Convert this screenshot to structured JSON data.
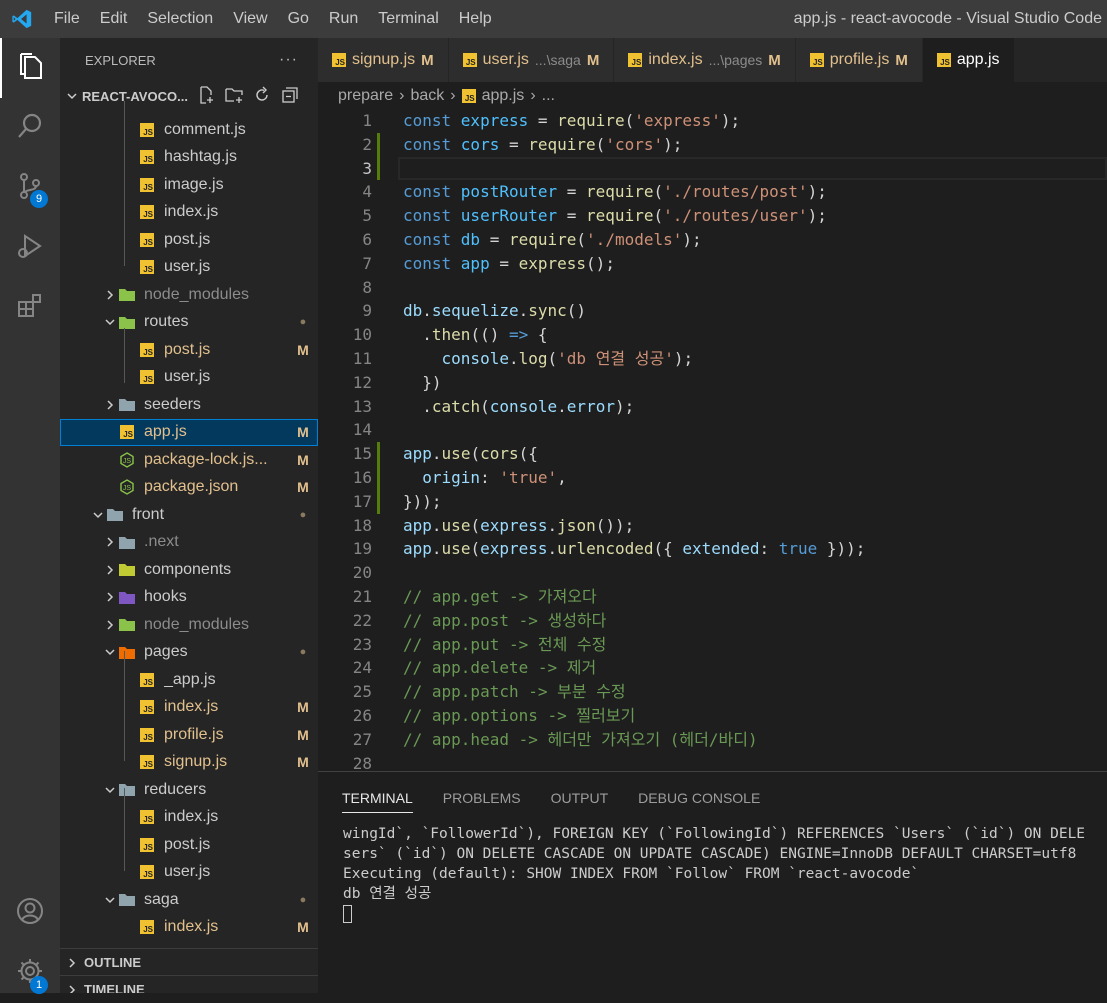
{
  "titlebar": {
    "menu": [
      "File",
      "Edit",
      "Selection",
      "View",
      "Go",
      "Run",
      "Terminal",
      "Help"
    ],
    "title": "app.js - react-avocode - Visual Studio Code"
  },
  "activitybar": {
    "scm_badge": "9",
    "settings_badge": "1"
  },
  "sidebar": {
    "header": "EXPLORER",
    "more": "···",
    "workspace": "REACT-AVOCO...",
    "outline": "OUTLINE",
    "timeline": "TIMELINE",
    "tree": [
      {
        "name": "comment.js",
        "type": "js",
        "depth": 3,
        "status": ""
      },
      {
        "name": "hashtag.js",
        "type": "js",
        "depth": 3,
        "status": ""
      },
      {
        "name": "image.js",
        "type": "js",
        "depth": 3,
        "status": ""
      },
      {
        "name": "index.js",
        "type": "js",
        "depth": 3,
        "status": ""
      },
      {
        "name": "post.js",
        "type": "js",
        "depth": 3,
        "status": ""
      },
      {
        "name": "user.js",
        "type": "js",
        "depth": 3,
        "status": ""
      },
      {
        "name": "node_modules",
        "type": "folder-node",
        "depth": 2,
        "chev": "right",
        "status": "",
        "dim": true
      },
      {
        "name": "routes",
        "type": "folder-routes",
        "depth": 2,
        "chev": "down",
        "status": "dot"
      },
      {
        "name": "post.js",
        "type": "js",
        "depth": 3,
        "status": "M"
      },
      {
        "name": "user.js",
        "type": "js",
        "depth": 3,
        "status": ""
      },
      {
        "name": "seeders",
        "type": "folder",
        "depth": 2,
        "chev": "right",
        "status": ""
      },
      {
        "name": "app.js",
        "type": "js",
        "depth": 2,
        "status": "M",
        "selected": true
      },
      {
        "name": "package-lock.js...",
        "type": "json",
        "depth": 2,
        "status": "M"
      },
      {
        "name": "package.json",
        "type": "json",
        "depth": 2,
        "status": "M"
      },
      {
        "name": "front",
        "type": "folder-open",
        "depth": 1,
        "chev": "down",
        "status": "dot"
      },
      {
        "name": ".next",
        "type": "folder-next",
        "depth": 2,
        "chev": "right",
        "status": "",
        "dim": true
      },
      {
        "name": "components",
        "type": "folder-comp",
        "depth": 2,
        "chev": "right",
        "status": ""
      },
      {
        "name": "hooks",
        "type": "folder-hooks",
        "depth": 2,
        "chev": "right",
        "status": ""
      },
      {
        "name": "node_modules",
        "type": "folder-node",
        "depth": 2,
        "chev": "right",
        "status": "",
        "dim": true
      },
      {
        "name": "pages",
        "type": "folder-pages",
        "depth": 2,
        "chev": "down",
        "status": "dot"
      },
      {
        "name": "_app.js",
        "type": "js",
        "depth": 3,
        "status": ""
      },
      {
        "name": "index.js",
        "type": "js",
        "depth": 3,
        "status": "M"
      },
      {
        "name": "profile.js",
        "type": "js",
        "depth": 3,
        "status": "M"
      },
      {
        "name": "signup.js",
        "type": "js",
        "depth": 3,
        "status": "M"
      },
      {
        "name": "reducers",
        "type": "folder-open",
        "depth": 2,
        "chev": "down",
        "status": ""
      },
      {
        "name": "index.js",
        "type": "js",
        "depth": 3,
        "status": ""
      },
      {
        "name": "post.js",
        "type": "js",
        "depth": 3,
        "status": ""
      },
      {
        "name": "user.js",
        "type": "js",
        "depth": 3,
        "status": ""
      },
      {
        "name": "saga",
        "type": "folder-open",
        "depth": 2,
        "chev": "down",
        "status": "dot"
      },
      {
        "name": "index.js",
        "type": "js",
        "depth": 3,
        "status": "M"
      }
    ]
  },
  "tabs": [
    {
      "name": "signup.js",
      "path": "",
      "mod": "M",
      "active": false
    },
    {
      "name": "user.js",
      "path": "...\\saga",
      "mod": "M",
      "active": false
    },
    {
      "name": "index.js",
      "path": "...\\pages",
      "mod": "M",
      "active": false
    },
    {
      "name": "profile.js",
      "path": "",
      "mod": "M",
      "active": false
    },
    {
      "name": "app.js",
      "path": "",
      "mod": "",
      "active": true
    }
  ],
  "breadcrumb": [
    "prepare",
    "back",
    "app.js",
    "..."
  ],
  "editor": {
    "current_line": 3,
    "git_added_ranges": [
      [
        2,
        3
      ],
      [
        15,
        17
      ]
    ],
    "lines": [
      [
        [
          "k",
          "const "
        ],
        [
          "v",
          "express"
        ],
        [
          "o",
          " = "
        ],
        [
          "f",
          "require"
        ],
        [
          "o",
          "("
        ],
        [
          "s",
          "'express'"
        ],
        [
          "o",
          ");"
        ]
      ],
      [
        [
          "k",
          "const "
        ],
        [
          "v",
          "cors"
        ],
        [
          "o",
          " = "
        ],
        [
          "f",
          "require"
        ],
        [
          "o",
          "("
        ],
        [
          "s",
          "'cors'"
        ],
        [
          "o",
          ");"
        ]
      ],
      [],
      [
        [
          "k",
          "const "
        ],
        [
          "v",
          "postRouter"
        ],
        [
          "o",
          " = "
        ],
        [
          "f",
          "require"
        ],
        [
          "o",
          "("
        ],
        [
          "s",
          "'./routes/post'"
        ],
        [
          "o",
          ");"
        ]
      ],
      [
        [
          "k",
          "const "
        ],
        [
          "v",
          "userRouter"
        ],
        [
          "o",
          " = "
        ],
        [
          "f",
          "require"
        ],
        [
          "o",
          "("
        ],
        [
          "s",
          "'./routes/user'"
        ],
        [
          "o",
          ");"
        ]
      ],
      [
        [
          "k",
          "const "
        ],
        [
          "v",
          "db"
        ],
        [
          "o",
          " = "
        ],
        [
          "f",
          "require"
        ],
        [
          "o",
          "("
        ],
        [
          "s",
          "'./models'"
        ],
        [
          "o",
          ");"
        ]
      ],
      [
        [
          "k",
          "const "
        ],
        [
          "v",
          "app"
        ],
        [
          "o",
          " = "
        ],
        [
          "f",
          "express"
        ],
        [
          "o",
          "();"
        ]
      ],
      [],
      [
        [
          "p",
          "db"
        ],
        [
          "o",
          "."
        ],
        [
          "p",
          "sequelize"
        ],
        [
          "o",
          "."
        ],
        [
          "f",
          "sync"
        ],
        [
          "o",
          "()"
        ]
      ],
      [
        [
          "o",
          "  ."
        ],
        [
          "f",
          "then"
        ],
        [
          "o",
          "(() "
        ],
        [
          "k",
          "=>"
        ],
        [
          "o",
          " {"
        ]
      ],
      [
        [
          "o",
          "    "
        ],
        [
          "p",
          "console"
        ],
        [
          "o",
          "."
        ],
        [
          "f",
          "log"
        ],
        [
          "o",
          "("
        ],
        [
          "s",
          "'db 연결 성공'"
        ],
        [
          "o",
          ");"
        ]
      ],
      [
        [
          "o",
          "  })"
        ]
      ],
      [
        [
          "o",
          "  ."
        ],
        [
          "f",
          "catch"
        ],
        [
          "o",
          "("
        ],
        [
          "p",
          "console"
        ],
        [
          "o",
          "."
        ],
        [
          "p",
          "error"
        ],
        [
          "o",
          ");"
        ]
      ],
      [],
      [
        [
          "p",
          "app"
        ],
        [
          "o",
          "."
        ],
        [
          "f",
          "use"
        ],
        [
          "o",
          "("
        ],
        [
          "f",
          "cors"
        ],
        [
          "o",
          "({"
        ]
      ],
      [
        [
          "o",
          "  "
        ],
        [
          "p",
          "origin"
        ],
        [
          "o",
          ": "
        ],
        [
          "s",
          "'true'"
        ],
        [
          "o",
          ","
        ]
      ],
      [
        [
          "o",
          "}));"
        ]
      ],
      [
        [
          "p",
          "app"
        ],
        [
          "o",
          "."
        ],
        [
          "f",
          "use"
        ],
        [
          "o",
          "("
        ],
        [
          "p",
          "express"
        ],
        [
          "o",
          "."
        ],
        [
          "f",
          "json"
        ],
        [
          "o",
          "());"
        ]
      ],
      [
        [
          "p",
          "app"
        ],
        [
          "o",
          "."
        ],
        [
          "f",
          "use"
        ],
        [
          "o",
          "("
        ],
        [
          "p",
          "express"
        ],
        [
          "o",
          "."
        ],
        [
          "f",
          "urlencoded"
        ],
        [
          "o",
          "({ "
        ],
        [
          "p",
          "extended"
        ],
        [
          "o",
          ": "
        ],
        [
          "k",
          "true"
        ],
        [
          "o",
          " }));"
        ]
      ],
      [],
      [
        [
          "c",
          "// app.get -> 가져오다"
        ]
      ],
      [
        [
          "c",
          "// app.post -> 생성하다"
        ]
      ],
      [
        [
          "c",
          "// app.put -> 전체 수정"
        ]
      ],
      [
        [
          "c",
          "// app.delete -> 제거"
        ]
      ],
      [
        [
          "c",
          "// app.patch -> 부분 수정"
        ]
      ],
      [
        [
          "c",
          "// app.options -> 찔러보기"
        ]
      ],
      [
        [
          "c",
          "// app.head -> 헤더만 가져오기 (헤더/바디)"
        ]
      ],
      []
    ]
  },
  "panel": {
    "tabs": [
      "TERMINAL",
      "PROBLEMS",
      "OUTPUT",
      "DEBUG CONSOLE"
    ],
    "active_tab": "TERMINAL",
    "terminal_lines": [
      "wingId`, `FollowerId`), FOREIGN KEY (`FollowingId`) REFERENCES `Users` (`id`) ON DELE",
      "sers` (`id`) ON DELETE CASCADE ON UPDATE CASCADE) ENGINE=InnoDB DEFAULT CHARSET=utf8",
      "Executing (default): SHOW INDEX FROM `Follow` FROM `react-avocode`",
      "db 연결 성공"
    ]
  }
}
